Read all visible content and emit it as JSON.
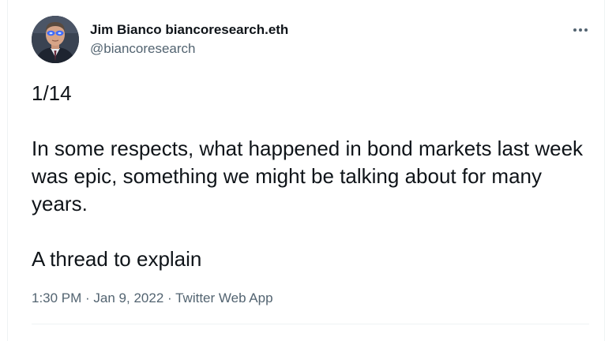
{
  "author": {
    "display_name": "Jim Bianco biancoresearch.eth",
    "handle": "@biancoresearch",
    "avatar_icon": "profile-photo-laser-eyes"
  },
  "more_icon": "more-horizontal-icon",
  "tweet": {
    "paragraphs": [
      "1/14",
      "In some respects, what happened in bond markets last week was epic, something we might be talking about for many years.",
      "A thread to explain"
    ],
    "time": "1:30 PM",
    "separator": " · ",
    "date": "Jan 9, 2022",
    "source": "Twitter Web App"
  },
  "colors": {
    "text_primary": "#0f1419",
    "text_secondary": "#536471",
    "divider": "#eff3f4",
    "laser_eyes": "#3d6bff"
  }
}
